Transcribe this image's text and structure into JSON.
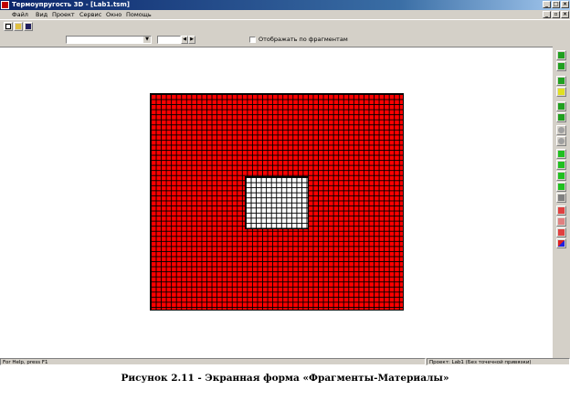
{
  "window": {
    "title": "Термоупругость 3D - [Lab1.tsm]"
  },
  "menu": [
    "Файл",
    "Вид",
    "Проект",
    "Сервис",
    "Окно",
    "Помощь"
  ],
  "toolbar": {
    "fragment_combo_value": "",
    "spin_value": "",
    "show_by_fragments_label": "Отображать по фрагментам",
    "show_by_fragments_checked": false
  },
  "status": {
    "left": "For Help, press F1",
    "right": "Проект: Lab1 (Без точечной привязки)"
  },
  "caption": "Рисунок 2.11 - Экранная форма «Фрагменты-Материалы»",
  "colors": {
    "material_fill": "#ff0000",
    "hole_fill": "#ffffff",
    "titlebar": "#0a246a"
  }
}
